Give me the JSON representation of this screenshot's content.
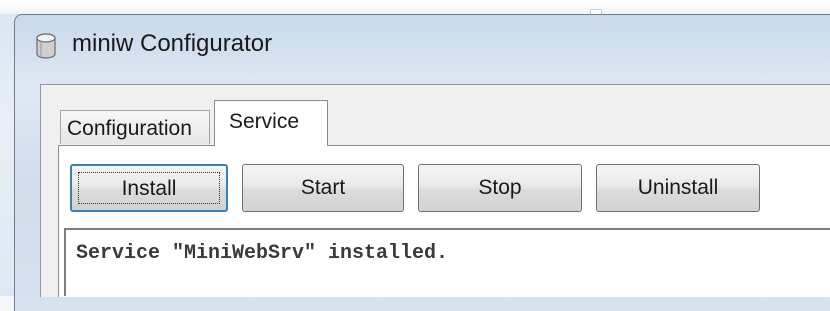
{
  "window": {
    "title": "miniw Configurator",
    "icon": "app-cylinder-icon"
  },
  "tabs": [
    {
      "label": "Configuration",
      "active": false
    },
    {
      "label": "Service",
      "active": true
    }
  ],
  "buttons": {
    "install": "Install",
    "start": "Start",
    "stop": "Stop",
    "uninstall": "Uninstall"
  },
  "output": {
    "text": "Service \"MiniWebSrv\" installed."
  },
  "colors": {
    "focus_border": "#3c7fb1",
    "window_frame": "#d6e2ee"
  }
}
